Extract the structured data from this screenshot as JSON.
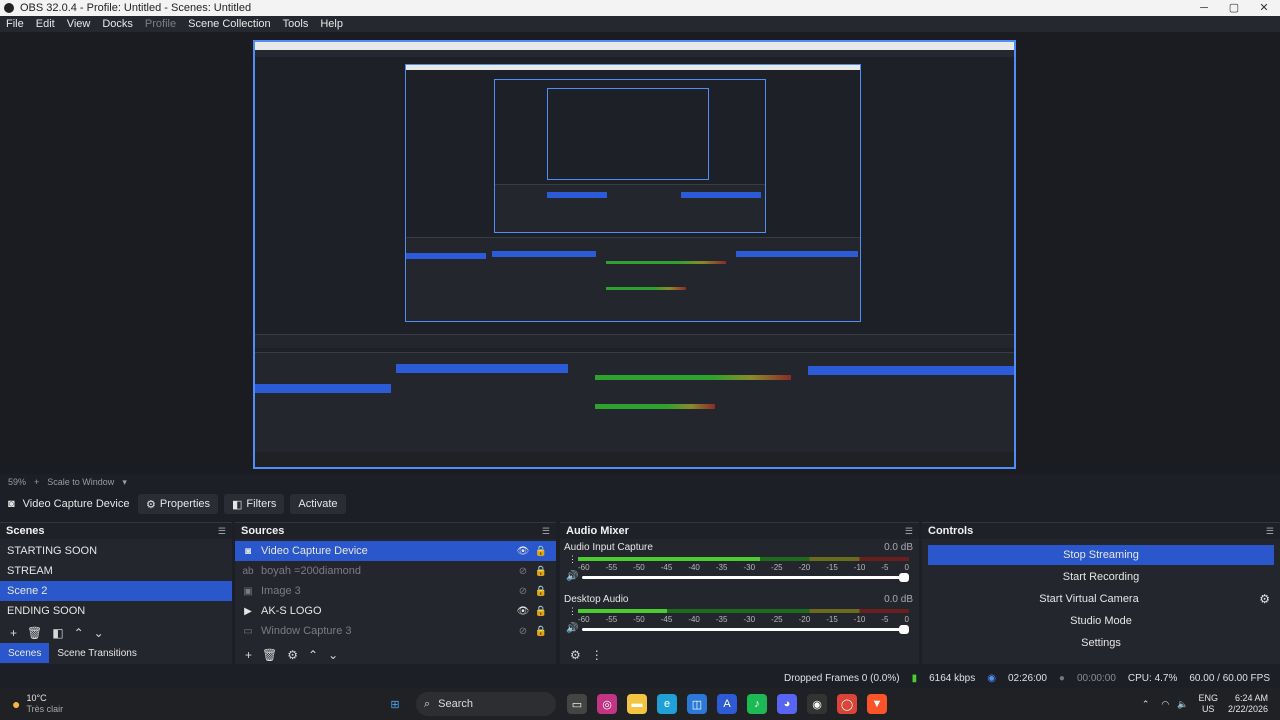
{
  "window": {
    "title": "OBS 32.0.4 - Profile: Untitled - Scenes: Untitled",
    "min": "─",
    "max": "▢",
    "close": "✕"
  },
  "menu": [
    "File",
    "Edit",
    "View",
    "Docks",
    "Profile",
    "Scene Collection",
    "Tools",
    "Help"
  ],
  "scale": {
    "zoom": "59%",
    "plus": "+",
    "mode": "Scale to Window"
  },
  "source_bar": {
    "name": "Video Capture Device",
    "properties": "Properties",
    "filters": "Filters",
    "activate": "Activate"
  },
  "scenes": {
    "title": "Scenes",
    "items": [
      "STARTING SOON",
      "STREAM",
      "Scene 2",
      "ENDING SOON"
    ],
    "selected": "Scene 2",
    "tabs": [
      "Scenes",
      "Scene Transitions"
    ]
  },
  "sources": {
    "title": "Sources",
    "items": [
      {
        "name": "Video Capture Device",
        "icon": "camera-icon",
        "visible": true
      },
      {
        "name": "boyah =200diamond",
        "icon": "text-icon",
        "visible": false
      },
      {
        "name": "Image 3",
        "icon": "image-icon",
        "visible": false
      },
      {
        "name": "AK-S LOGO",
        "icon": "media-icon",
        "visible": true
      },
      {
        "name": "Window Capture 3",
        "icon": "window-icon",
        "visible": false
      }
    ]
  },
  "mixer": {
    "title": "Audio Mixer",
    "tracks": [
      {
        "name": "Audio Input Capture",
        "db": "0.0 dB",
        "level": 0.55
      },
      {
        "name": "Desktop Audio",
        "db": "0.0 dB",
        "level": 0.27
      }
    ],
    "ticks": [
      "-60",
      "-55",
      "-50",
      "-45",
      "-40",
      "-35",
      "-30",
      "-25",
      "-20",
      "-15",
      "-10",
      "-5",
      "0"
    ]
  },
  "controls": {
    "title": "Controls",
    "buttons": [
      "Stop Streaming",
      "Start Recording",
      "Start Virtual Camera",
      "Studio Mode",
      "Settings"
    ]
  },
  "status": {
    "dropped": "Dropped Frames 0 (0.0%)",
    "kbps": "6164 kbps",
    "stream_time": "02:26:00",
    "rec_time": "00:00:00",
    "cpu": "CPU: 4.7%",
    "fps": "60.00 / 60.00 FPS"
  },
  "taskbar": {
    "weather_temp": "10°C",
    "weather_desc": "Très clair",
    "search": "Search",
    "lang": "ENG",
    "region": "US",
    "time": "6:24 AM",
    "date": "2/22/2026"
  },
  "colors": {
    "accent": "#2a57cc",
    "preview_border": "#4f8ef7"
  }
}
